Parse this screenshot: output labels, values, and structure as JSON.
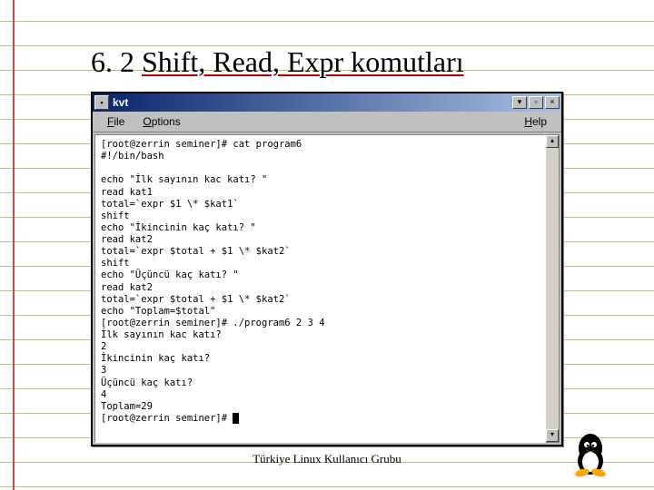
{
  "slide": {
    "number": "6. 2",
    "title_rest": "Shift, Read, Expr komutları"
  },
  "window": {
    "title": "kvt",
    "menu": {
      "file": "File",
      "options": "Options",
      "help": "Help"
    }
  },
  "terminal": {
    "lines": [
      "[root@zerrin seminer]# cat program6",
      "#!/bin/bash",
      "",
      "echo \"İlk sayının kac katı? \"",
      "read kat1",
      "total=`expr $1 \\* $kat1`",
      "shift",
      "echo \"İkincinin kaç katı? \"",
      "read kat2",
      "total=`expr $total + $1 \\* $kat2`",
      "shift",
      "echo \"Üçüncü kaç katı? \"",
      "read kat2",
      "total=`expr $total + $1 \\* $kat2`",
      "echo \"Toplam=$total\"",
      "[root@zerrin seminer]# ./program6 2 3 4",
      "İlk sayının kac katı?",
      "2",
      "İkincinin kaç katı?",
      "3",
      "Üçüncü kaç katı?",
      "4",
      "Toplam=29",
      "[root@zerrin seminer]# "
    ]
  },
  "footer": "Türkiye Linux Kullanıcı Grubu"
}
